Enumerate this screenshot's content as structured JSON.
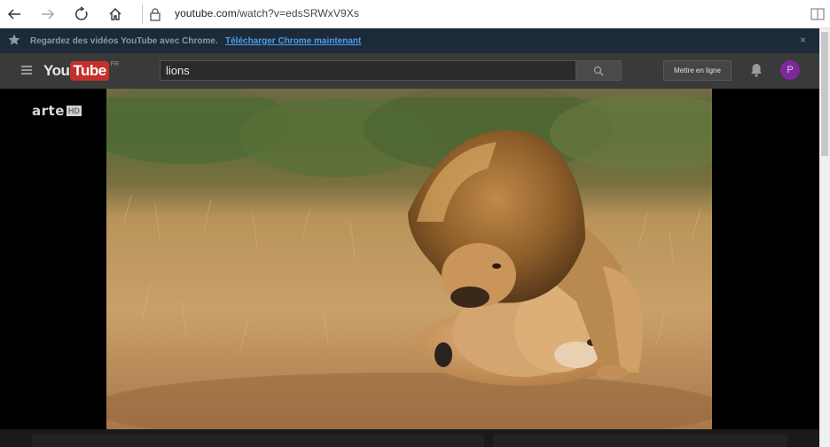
{
  "browser": {
    "url_host": "youtube.com",
    "url_path": "/watch?v=edsSRWxV9Xs",
    "icons": [
      "back-arrow-icon",
      "forward-arrow-icon",
      "refresh-icon",
      "home-icon",
      "lock-icon",
      "reading-view-icon"
    ]
  },
  "promo": {
    "message": "Regardez des vidéos YouTube avec Chrome.",
    "link": "Télécharger Chrome maintenant",
    "close": "×"
  },
  "masthead": {
    "logo_you": "You",
    "logo_tube": "Tube",
    "country_code": "FR",
    "search_value": "lions",
    "upload_label": "Mettre en ligne",
    "avatar_letter": "P"
  },
  "video": {
    "watermark_brand": "arte",
    "watermark_quality": "HD"
  },
  "colors": {
    "youtube_red": "#c4302b",
    "promo_bg": "#1c2a3a",
    "promo_link": "#4e9ee8",
    "masthead_bg": "#3a3a3a",
    "avatar_bg": "#7b2a9b"
  }
}
